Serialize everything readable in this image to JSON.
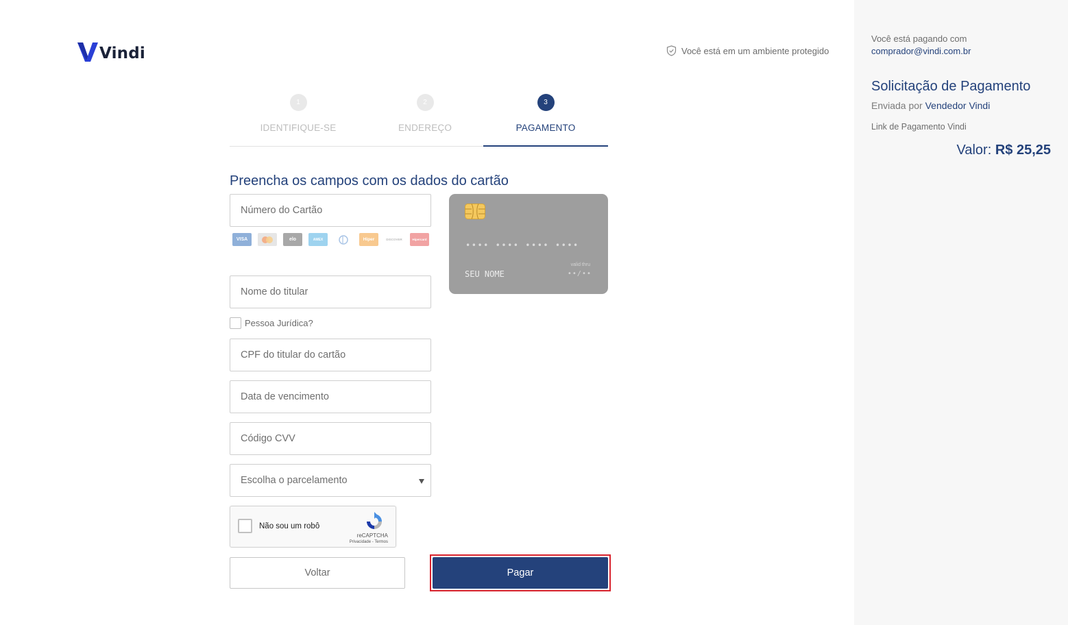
{
  "header": {
    "logo_text": "Vindi",
    "secure_text": "Você está em um ambiente protegido"
  },
  "steps": [
    {
      "number": "1",
      "label": "IDENTIFIQUE-SE",
      "state": "done"
    },
    {
      "number": "2",
      "label": "ENDEREÇO",
      "state": "done"
    },
    {
      "number": "3",
      "label": "PAGAMENTO",
      "state": "active"
    }
  ],
  "form": {
    "title": "Preencha os campos com os dados do cartão",
    "card_number_placeholder": "Número do Cartão",
    "holder_name_placeholder": "Nome do titular",
    "pj_label": "Pessoa Jurídica?",
    "cpf_placeholder": "CPF do titular do cartão",
    "expiry_placeholder": "Data de vencimento",
    "cvv_placeholder": "Código CVV",
    "installments_placeholder": "Escolha o parcelamento",
    "brands": [
      {
        "name": "VISA",
        "color": "#8fb0d9"
      },
      {
        "name": "",
        "color": "#f3c9a5"
      },
      {
        "name": "elo",
        "color": "#a8a8a8"
      },
      {
        "name": "AMEX",
        "color": "#9ed3ef"
      },
      {
        "name": "",
        "color": "#ffffff"
      },
      {
        "name": "Hiper",
        "color": "#f8c98f"
      },
      {
        "name": "DISCOVER",
        "color": "#ffffff"
      },
      {
        "name": "Hipercard",
        "color": "#f1a3a3"
      }
    ]
  },
  "card_preview": {
    "number": "•••• •••• •••• ••••",
    "name": "SEU NOME",
    "valid_label": "valid thru",
    "valid": "••/••"
  },
  "recaptcha": {
    "label": "Não sou um robô",
    "brand": "reCAPTCHA",
    "links": "Privacidade - Termos"
  },
  "buttons": {
    "back": "Voltar",
    "pay": "Pagar"
  },
  "side": {
    "paying_with": "Você está pagando com",
    "email": "comprador@vindi.com.br",
    "request_title": "Solicitação de Pagamento",
    "sent_by_prefix": "Enviada por",
    "vendor": "Vendedor Vindi",
    "link_label": "Link de Pagamento Vindi",
    "value_label": "Valor:",
    "value_amount": "R$ 25,25"
  },
  "colors": {
    "primary": "#24427b",
    "highlight": "#d9232d",
    "side_bg": "#f7f7f7"
  }
}
